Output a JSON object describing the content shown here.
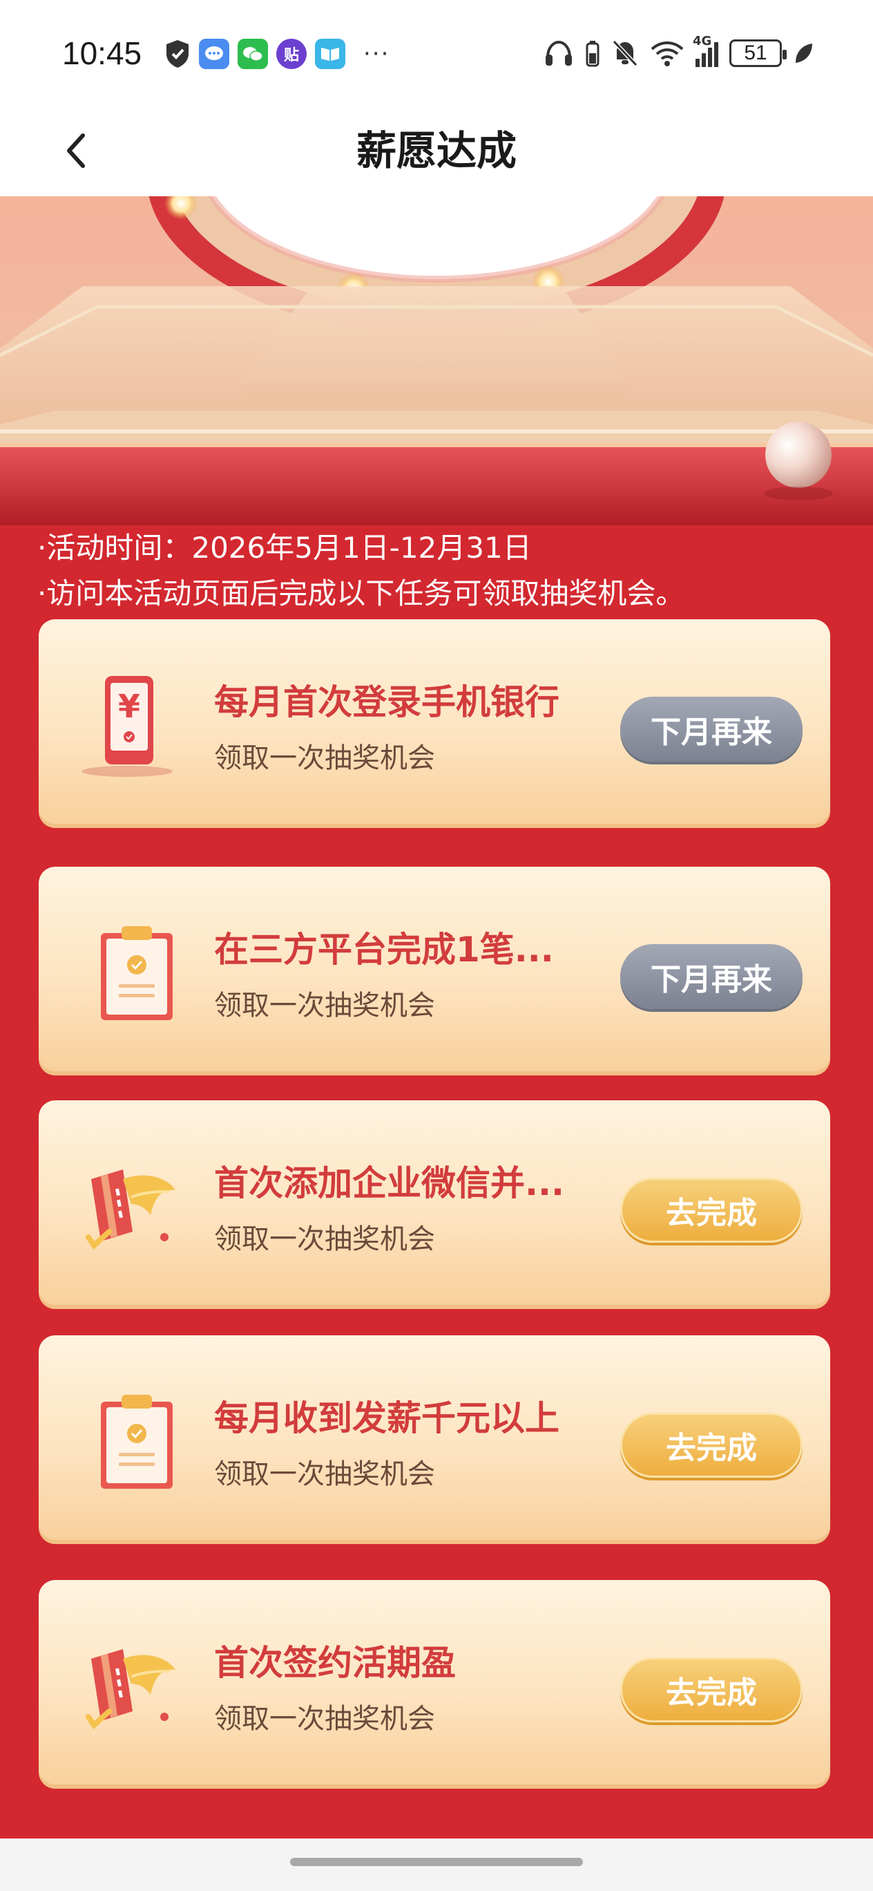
{
  "status_bar": {
    "time": "10:45",
    "app_icons": [
      {
        "name": "shield-icon"
      },
      {
        "name": "message-app-icon",
        "color": "#4a8cf0"
      },
      {
        "name": "wechat-app-icon",
        "color": "#2dbd4e"
      },
      {
        "name": "tieba-app-icon",
        "glyph": "贴",
        "color": "#6b3fd0"
      },
      {
        "name": "reader-app-icon",
        "color": "#3ab6e8"
      }
    ],
    "more": "···",
    "signal_label": "4G",
    "battery": "51"
  },
  "header": {
    "title": "薪愿达成",
    "back_icon": "chevron-left-icon"
  },
  "notes": {
    "time_line": "·活动时间：2026年5月1日-12月31日",
    "desc_line": "·访问本活动页面后完成以下任务可领取抽奖机会。"
  },
  "tasks": [
    {
      "title": "每月首次登录手机银行",
      "subtitle": "领取一次抽奖机会",
      "button": "下月再来",
      "state": "done",
      "icon": "phone-yen-icon"
    },
    {
      "title": "在三方平台完成1笔...",
      "subtitle": "领取一次抽奖机会",
      "button": "下月再来",
      "state": "done",
      "icon": "clipboard-check-icon"
    },
    {
      "title": "首次添加企业微信并...",
      "subtitle": "领取一次抽奖机会",
      "button": "去完成",
      "state": "todo",
      "icon": "bank-card-icon"
    },
    {
      "title": "每月收到发薪千元以上",
      "subtitle": "领取一次抽奖机会",
      "button": "去完成",
      "state": "todo",
      "icon": "clipboard-check-icon"
    },
    {
      "title": "首次签约活期盈",
      "subtitle": "领取一次抽奖机会",
      "button": "去完成",
      "state": "todo",
      "icon": "bank-card-icon"
    }
  ],
  "colors": {
    "page_red": "#d3282f",
    "title_red": "#d23c3c",
    "button_grey": "#8a8f9c",
    "button_gold": "#f0b445"
  }
}
